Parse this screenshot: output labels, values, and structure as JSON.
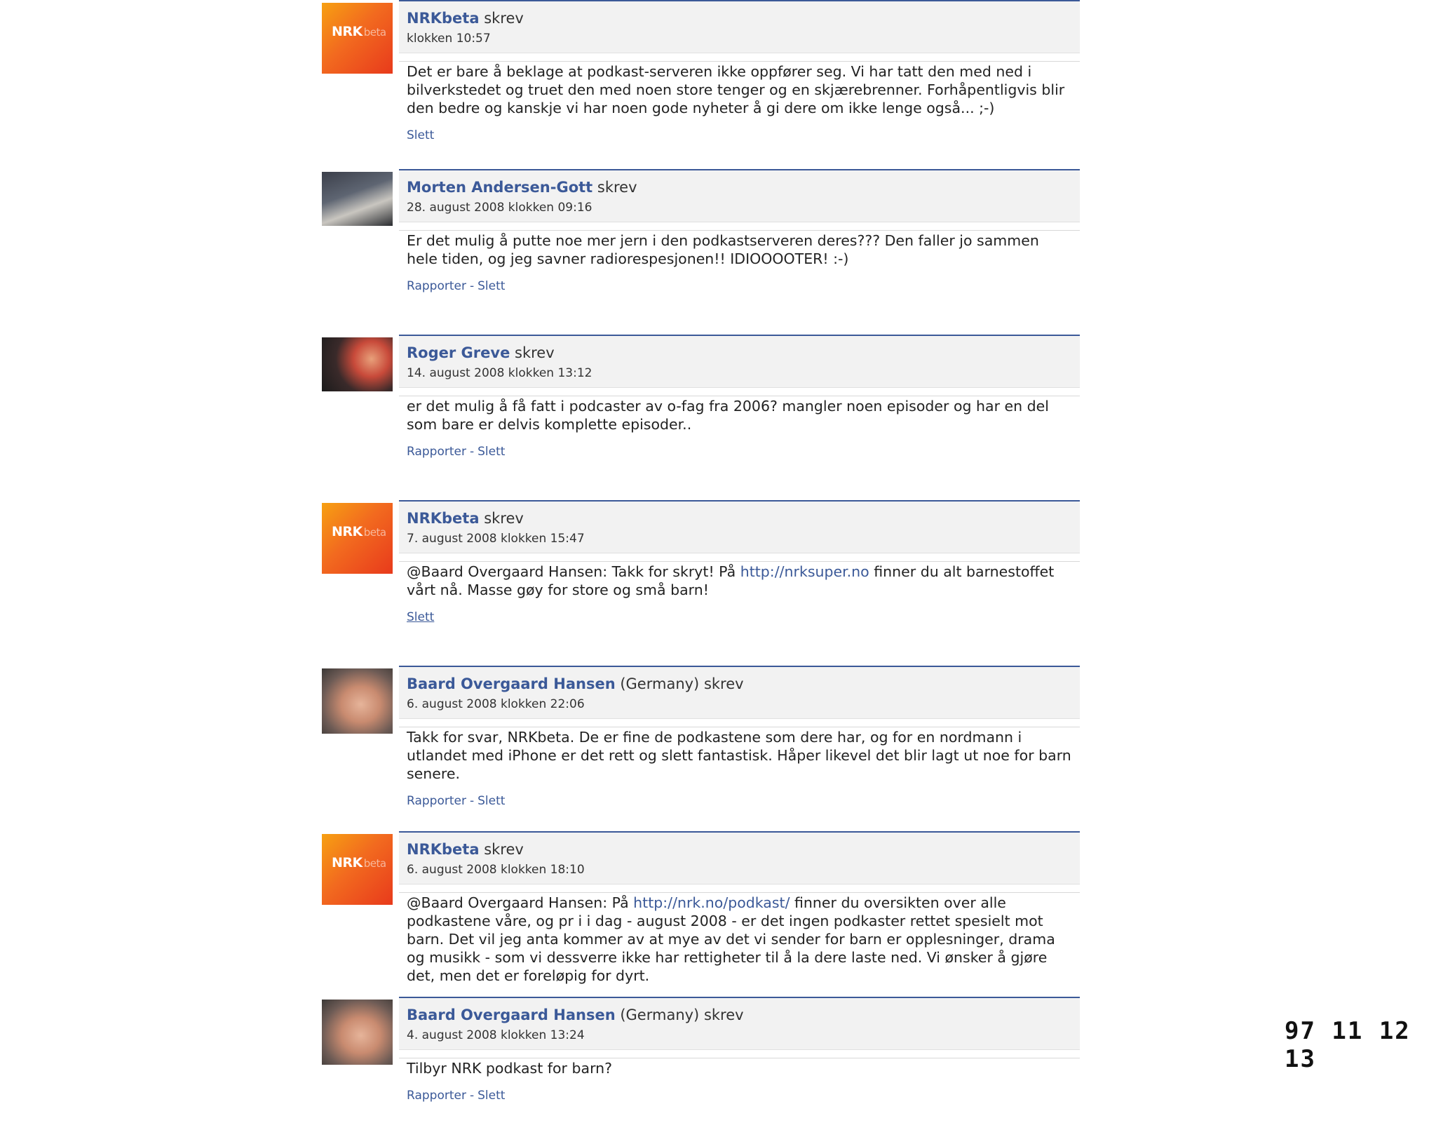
{
  "posts": [
    {
      "author": "NRKbeta",
      "location": "",
      "wrote": "skrev",
      "time": "klokken 10:57",
      "avatar": "nrkbeta-logo",
      "segments": [
        {
          "text": "Det er bare å beklage at podkast-serveren ikke oppfører seg. Vi har tatt den med ned i bilverkstedet og truet den med noen store tenger og en skjærebrenner. Forhåpentligvis blir den bedre og kanskje vi har noen gode nyheter å gi dere om ikke lenge også... ;-)"
        }
      ],
      "actions": [
        "Slett"
      ]
    },
    {
      "author": "Morten Andersen-Gott",
      "location": "",
      "wrote": "skrev",
      "time": "28. august 2008 klokken 09:16",
      "avatar": "user-photo",
      "segments": [
        {
          "text": "Er det mulig å putte noe mer jern i den podkastserveren deres??? Den faller jo sammen hele tiden, og jeg savner radiorespesjonen!! IDIOOOOTER! :-)"
        }
      ],
      "actions": [
        "Rapporter",
        "Slett"
      ]
    },
    {
      "author": "Roger Greve",
      "location": "",
      "wrote": "skrev",
      "time": "14. august 2008 klokken 13:12",
      "avatar": "user-photo",
      "segments": [
        {
          "text": "er det mulig å få fatt i podcaster av o-fag fra 2006? mangler noen episoder og har en del som bare er delvis komplette episoder.."
        }
      ],
      "actions": [
        "Rapporter",
        "Slett"
      ]
    },
    {
      "author": "NRKbeta",
      "location": "",
      "wrote": "skrev",
      "time": "7. august 2008 klokken 15:47",
      "avatar": "nrkbeta-logo",
      "segments": [
        {
          "text": "@Baard Overgaard Hansen: Takk for skryt! På "
        },
        {
          "text": "http://nrksuper.no",
          "link": true
        },
        {
          "text": " finner du alt barnestoffet vårt nå. Masse gøy for store og små barn!"
        }
      ],
      "actions": [
        "Slett"
      ]
    },
    {
      "author": "Baard Overgaard Hansen",
      "location": "(Germany)",
      "wrote": "skrev",
      "time": "6. august 2008 klokken 22:06",
      "avatar": "user-photo",
      "segments": [
        {
          "text": "Takk for svar, NRKbeta. De er fine de podkastene som dere har, og for en nordmann i utlandet med iPhone er det rett og slett fantastisk. Håper likevel det blir lagt ut noe for barn senere."
        }
      ],
      "actions": [
        "Rapporter",
        "Slett"
      ]
    },
    {
      "author": "NRKbeta",
      "location": "",
      "wrote": "skrev",
      "time": "6. august 2008 klokken 18:10",
      "avatar": "nrkbeta-logo",
      "segments": [
        {
          "text": "@Baard Overgaard Hansen: På "
        },
        {
          "text": "http://nrk.no/podkast/",
          "link": true
        },
        {
          "text": " finner du oversikten over alle podkastene våre, og pr i i dag - august 2008 - er det ingen podkaster rettet spesielt mot barn. Det vil jeg anta kommer av at mye av det vi sender for barn er opplesninger, drama og musikk - som vi dessverre ikke har rettigheter til å la dere laste ned. Vi ønsker å gjøre det, men det er foreløpig for dyrt."
        }
      ],
      "actions": [
        "Slett"
      ]
    },
    {
      "author": "Baard Overgaard Hansen",
      "location": "(Germany)",
      "wrote": "skrev",
      "time": "4. august 2008 klokken 13:24",
      "avatar": "user-photo",
      "segments": [
        {
          "text": "Tilbyr NRK podkast for barn?"
        }
      ],
      "actions": [
        "Rapporter",
        "Slett"
      ]
    }
  ],
  "avatar_logo": {
    "brand": "NRK",
    "sub": "beta"
  },
  "slide_number": "97 11 12 13",
  "colors": {
    "accent": "#3b5998",
    "header_bg": "#f2f2f2",
    "nrk_orange": "#f26a1f"
  }
}
